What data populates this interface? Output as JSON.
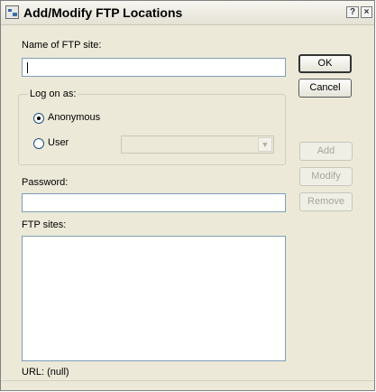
{
  "window": {
    "title": "Add/Modify FTP Locations",
    "help_glyph": "?",
    "close_glyph": "×"
  },
  "form": {
    "site_name_label": "Name of FTP site:",
    "site_name_value": "",
    "logon_group_label": "Log on as:",
    "anonymous_label": "Anonymous",
    "user_label": "User",
    "anonymous_selected": true,
    "user_combo_value": "",
    "password_label": "Password:",
    "password_value": "",
    "ftp_sites_label": "FTP sites:",
    "ftp_sites": [],
    "url_status": "URL: (null)"
  },
  "buttons": {
    "ok": "OK",
    "cancel": "Cancel",
    "add": "Add",
    "modify": "Modify",
    "remove": "Remove"
  },
  "icons": {
    "app": "ftp-locations-icon",
    "combo_arrow": "chevron-down-icon"
  }
}
